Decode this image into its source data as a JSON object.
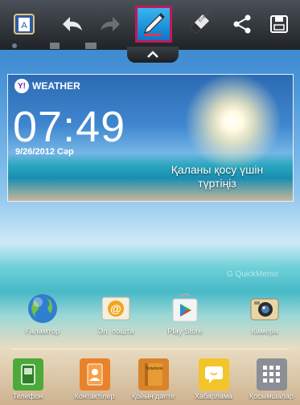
{
  "toolbar": {
    "icons": [
      "annotation-app-icon",
      "undo-icon",
      "redo-icon",
      "pen-icon",
      "eraser-icon",
      "share-icon",
      "save-icon"
    ],
    "active_color": "#c2185b"
  },
  "weather_widget": {
    "brand": "WEATHER",
    "time": "07:49",
    "date": "9/26/2012 Сәр",
    "tap_to_add_city": "Қаланы қосу үшін түртіңіз"
  },
  "watermark": "G QuickMemo",
  "home_apps": [
    {
      "label": "Ғаламтор",
      "icon": "globe-icon"
    },
    {
      "label": "Эл. пошта",
      "icon": "email-icon"
    },
    {
      "label": "Play Store",
      "icon": "play-store-icon"
    },
    {
      "label": "Камера",
      "icon": "camera-icon"
    }
  ],
  "dock": [
    {
      "label": "Телефон",
      "icon": "phone-icon"
    },
    {
      "label": "Контактілер",
      "icon": "contacts-icon"
    },
    {
      "label": "Қойын дәпте",
      "icon": "notebook-icon"
    },
    {
      "label": "Хабарлама",
      "icon": "messaging-icon"
    },
    {
      "label": "Қосымшалар",
      "icon": "apps-grid-icon"
    }
  ]
}
